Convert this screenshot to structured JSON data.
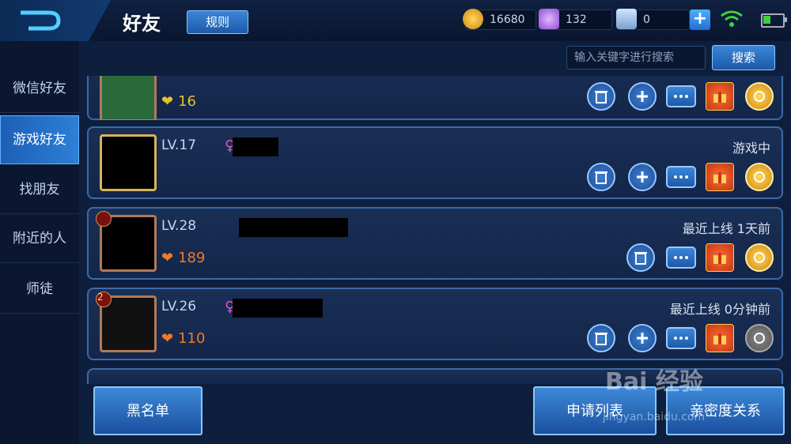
{
  "header": {
    "title": "好友",
    "rules_label": "规则",
    "gold": "16680",
    "diamond": "132",
    "voucher": "0",
    "plus": "+"
  },
  "sidebar": {
    "items": [
      {
        "label": "微信好友"
      },
      {
        "label": "游戏好友"
      },
      {
        "label": "找朋友"
      },
      {
        "label": "附近的人"
      },
      {
        "label": "师徒"
      }
    ],
    "active": "游戏好友"
  },
  "search": {
    "placeholder": "输入关键字进行搜索",
    "button": "搜索"
  },
  "friends": [
    {
      "level": "",
      "status": "",
      "intimacy": "16",
      "badge": ""
    },
    {
      "level": "LV.17",
      "status": "游戏中",
      "intimacy": "",
      "badge": ""
    },
    {
      "level": "LV.28",
      "status": "最近上线  1天前",
      "intimacy": "189",
      "badge": ""
    },
    {
      "level": "LV.26",
      "status": "最近上线  0分钟前",
      "intimacy": "110",
      "badge": "2"
    }
  ],
  "bottom": {
    "blacklist": "黑名单",
    "requests": "申请列表",
    "intimacy": "亲密度关系"
  },
  "watermark": {
    "brand": "Bai 经验",
    "url": "jingyan.baidu.com"
  },
  "colors": {
    "accent": "#2d7fd8",
    "gold_heart": "#e6c32a",
    "orange_heart": "#f07a2a"
  }
}
